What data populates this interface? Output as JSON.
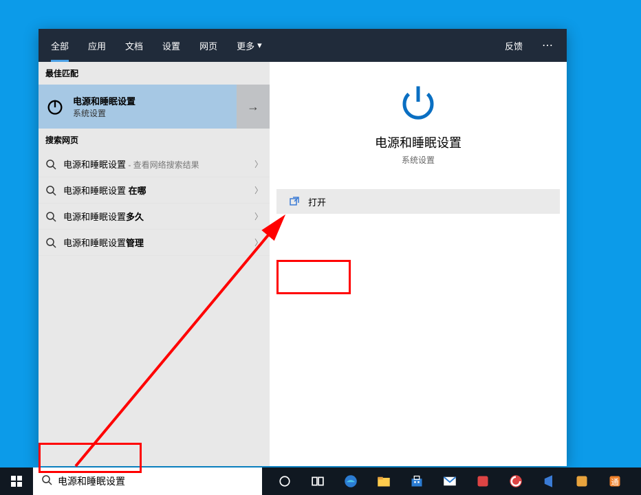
{
  "tabs": {
    "all": "全部",
    "apps": "应用",
    "docs": "文档",
    "settings": "设置",
    "web": "网页",
    "more": "更多",
    "feedback": "反馈"
  },
  "sections": {
    "best_match": "最佳匹配",
    "search_web": "搜索网页"
  },
  "best_match_item": {
    "title": "电源和睡眠设置",
    "subtitle": "系统设置"
  },
  "web_results": [
    {
      "base": "电源和睡眠设置",
      "suffix": " - 查看网络搜索结果",
      "suffix_type": "grey"
    },
    {
      "base": "电源和睡眠设置 ",
      "suffix": "在哪",
      "suffix_type": "bold"
    },
    {
      "base": "电源和睡眠设置",
      "suffix": "多久",
      "suffix_type": "bold"
    },
    {
      "base": "电源和睡眠设置",
      "suffix": "管理",
      "suffix_type": "bold"
    }
  ],
  "detail": {
    "title": "电源和睡眠设置",
    "subtitle": "系统设置",
    "open_label": "打开"
  },
  "search_input": {
    "value": "电源和睡眠设置"
  },
  "taskbar_icons": [
    "cortana-icon",
    "task-view-icon",
    "edge-icon",
    "explorer-icon",
    "store-icon",
    "mail-icon",
    "app1-icon",
    "ccleaner-icon",
    "vscode-icon",
    "app2-icon",
    "app3-icon"
  ]
}
